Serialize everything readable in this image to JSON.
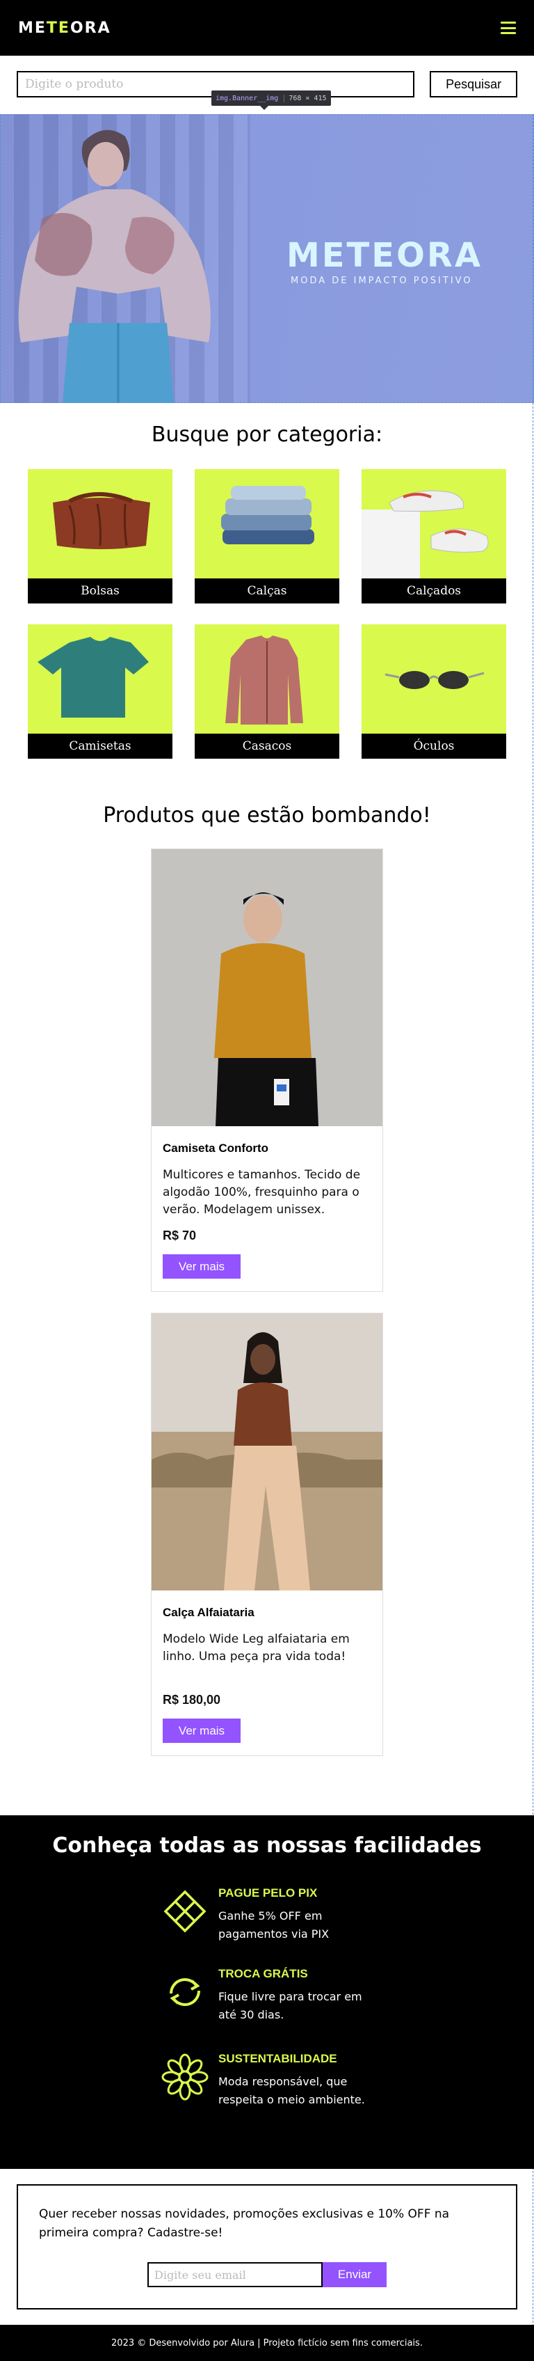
{
  "header": {
    "logo_left": "ME",
    "logo_mid": "TE",
    "logo_right": "ORA",
    "menu_icon": "hamburger-menu-icon"
  },
  "search": {
    "placeholder": "Digite o produto",
    "button": "Pesquisar"
  },
  "devtools_tip": {
    "tag": "img.Banner__img",
    "dims": "768 × 415"
  },
  "banner": {
    "logo": "METEORA",
    "tagline": "MODA DE IMPACTO POSITIVO"
  },
  "categories": {
    "title": "Busque por categoria:",
    "items": [
      {
        "label": "Bolsas"
      },
      {
        "label": "Calças"
      },
      {
        "label": "Calçados"
      },
      {
        "label": "Camisetas"
      },
      {
        "label": "Casacos"
      },
      {
        "label": "Óculos"
      }
    ]
  },
  "products": {
    "title": "Produtos que estão bombando!",
    "items": [
      {
        "name": "Camiseta Conforto",
        "desc": "Multicores e tamanhos. Tecido de algodão 100%, fresquinho para o verão. Modelagem unissex.",
        "price": "R$ 70",
        "button": "Ver mais"
      },
      {
        "name": "Calça Alfaiataria",
        "desc": "Modelo Wide Leg alfaiataria em linho. Uma peça pra vida toda!",
        "price": "R$ 180,00",
        "button": "Ver mais"
      }
    ]
  },
  "facilities": {
    "title": "Conheça todas as nossas facilidades",
    "items": [
      {
        "head": "PAGUE PELO PIX",
        "desc": "Ganhe 5% OFF em pagamentos via PIX",
        "icon": "pix-icon"
      },
      {
        "head": "TROCA GRÁTIS",
        "desc": "Fique livre para trocar em até 30 dias.",
        "icon": "exchange-arrows-icon"
      },
      {
        "head": "SUSTENTABILIDADE",
        "desc": "Moda responsável, que respeita o meio ambiente.",
        "icon": "flower-icon"
      }
    ]
  },
  "newsletter": {
    "text": "Quer receber nossas novidades, promoções exclusivas e 10% OFF na primeira compra? Cadastre-se!",
    "placeholder": "Digite seu email",
    "button": "Enviar"
  },
  "footer": {
    "text": "2023 © Desenvolvido por Alura | Projeto fictício sem fins comerciais."
  },
  "colors": {
    "accent": "#d9f94c",
    "purple": "#9353ff",
    "banner": "#8a9ade"
  }
}
